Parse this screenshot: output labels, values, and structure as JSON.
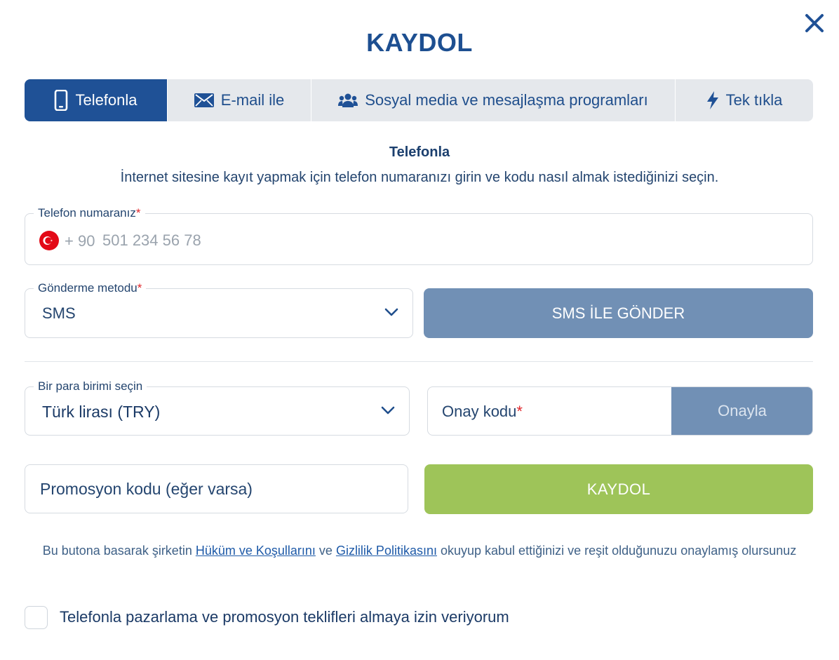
{
  "dialog": {
    "title": "KAYDOL"
  },
  "tabs": [
    {
      "label": "Telefonla",
      "icon": "phone-icon",
      "active": true
    },
    {
      "label": "E-mail ile",
      "icon": "envelope-icon",
      "active": false
    },
    {
      "label": "Sosyal media ve mesajlaşma programları",
      "icon": "users-icon",
      "active": false
    },
    {
      "label": "Tek tıkla",
      "icon": "bolt-icon",
      "active": false
    }
  ],
  "section": {
    "title": "Telefonla",
    "description": "İnternet sitesine kayıt yapmak için telefon numaranızı girin ve kodu nasıl almak istediğinizi seçin."
  },
  "phone": {
    "label": "Telefon numaranız",
    "required_mark": "*",
    "country_code": "+ 90",
    "placeholder": "501 234 56 78"
  },
  "send_method": {
    "label": "Gönderme metodu",
    "required_mark": "*",
    "value": "SMS"
  },
  "send_button": {
    "label": "SMS İLE GÖNDER"
  },
  "currency": {
    "label": "Bir para birimi seçin",
    "value": "Türk lirası (TRY)"
  },
  "confirmation_code": {
    "label": "Onay kodu",
    "required_mark": "*",
    "button_label": "Onayla"
  },
  "promo": {
    "placeholder": "Promosyon kodu (eğer varsa)"
  },
  "register_button": {
    "label": "KAYDOL"
  },
  "terms": {
    "prefix": "Bu butona basarak şirketin ",
    "link1": "Hüküm ve Koşullarını",
    "middle": " ve ",
    "link2": "Gizlilik Politikasını",
    "suffix": " okuyup kabul ettiğinizi ve reşit olduğunuzu onaylamış olursunuz"
  },
  "consent": {
    "label": "Telefonla pazarlama ve promosyon teklifleri almaya izin veriyorum",
    "checked": false
  },
  "colors": {
    "primary": "#1f5196",
    "muted_button": "#7190b5",
    "success": "#9ec459",
    "required": "#e0262b"
  }
}
